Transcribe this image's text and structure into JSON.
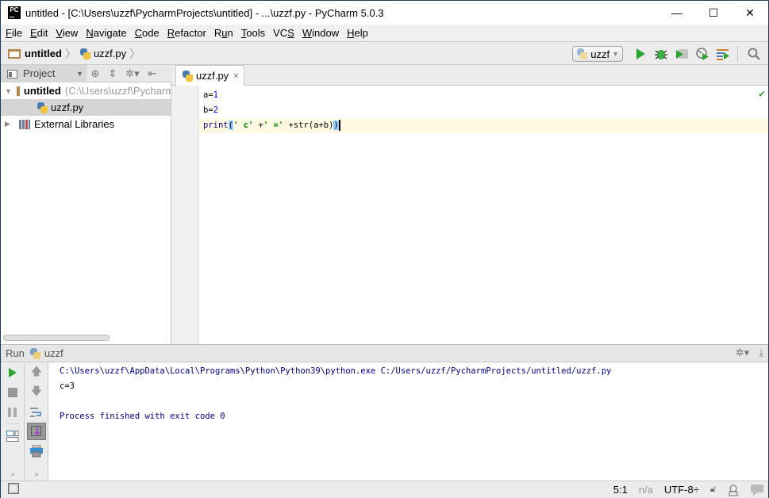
{
  "window": {
    "title": "untitled - [C:\\Users\\uzzf\\PycharmProjects\\untitled] - ...\\uzzf.py - PyCharm 5.0.3",
    "app_icon_text": "PC",
    "minimize": "—",
    "maximize": "☐",
    "close": "✕"
  },
  "menu": [
    {
      "label": "File",
      "mnemonic": "F",
      "rest": "ile"
    },
    {
      "label": "Edit",
      "mnemonic": "E",
      "rest": "dit"
    },
    {
      "label": "View",
      "mnemonic": "V",
      "rest": "iew"
    },
    {
      "label": "Navigate",
      "mnemonic": "N",
      "rest": "avigate"
    },
    {
      "label": "Code",
      "mnemonic": "C",
      "rest": "ode"
    },
    {
      "label": "Refactor",
      "mnemonic": "R",
      "rest": "efactor"
    },
    {
      "label": "Run",
      "pre": "R",
      "mnemonic": "u",
      "rest": "n"
    },
    {
      "label": "Tools",
      "mnemonic": "T",
      "rest": "ools"
    },
    {
      "label": "VCS",
      "pre": "VC",
      "mnemonic": "S",
      "rest": ""
    },
    {
      "label": "Window",
      "mnemonic": "W",
      "rest": "indow"
    },
    {
      "label": "Help",
      "mnemonic": "H",
      "rest": "elp"
    }
  ],
  "breadcrumb": {
    "project": "untitled",
    "file": "uzzf.py",
    "separator": "〉"
  },
  "toolbar": {
    "run_config": "uzzf",
    "buttons": [
      "run-icon",
      "debug-icon",
      "coverage-icon",
      "profile-icon",
      "concurrency-icon",
      "search-icon"
    ]
  },
  "project_panel": {
    "view_label": "Project",
    "tree": [
      {
        "label": "untitled",
        "hint": "(C:\\Users\\uzzf\\PycharmProjects\\untitled)",
        "type": "folder",
        "expanded": true
      },
      {
        "label": "uzzf.py",
        "type": "python-file",
        "selected": true
      },
      {
        "label": "External Libraries",
        "type": "library",
        "expanded": false
      }
    ]
  },
  "editor": {
    "tab_label": "uzzf.py",
    "tab_close": "×",
    "lines": [
      {
        "var": "a",
        "eq": "=",
        "val": "1"
      },
      {
        "var": "b",
        "eq": "=",
        "val": "2"
      }
    ],
    "line3": {
      "fn": "print",
      "open": "(",
      "s1": "' c'",
      "plus1": " +",
      "s2": "' ='",
      "rest": " +str(a+b)",
      "close": ")"
    },
    "inspection_status": "✔"
  },
  "run_panel": {
    "label": "Run",
    "config": "uzzf",
    "console": {
      "command": "C:\\Users\\uzzf\\AppData\\Local\\Programs\\Python\\Python39\\python.exe C:/Users/uzzf/PycharmProjects/untitled/uzzf.py",
      "output": "c=3",
      "blank": "",
      "exit": "Process finished with exit code 0"
    },
    "more": "»"
  },
  "statusbar": {
    "position": "5:1",
    "line_separator": "n/a",
    "encoding": "UTF-8÷"
  }
}
